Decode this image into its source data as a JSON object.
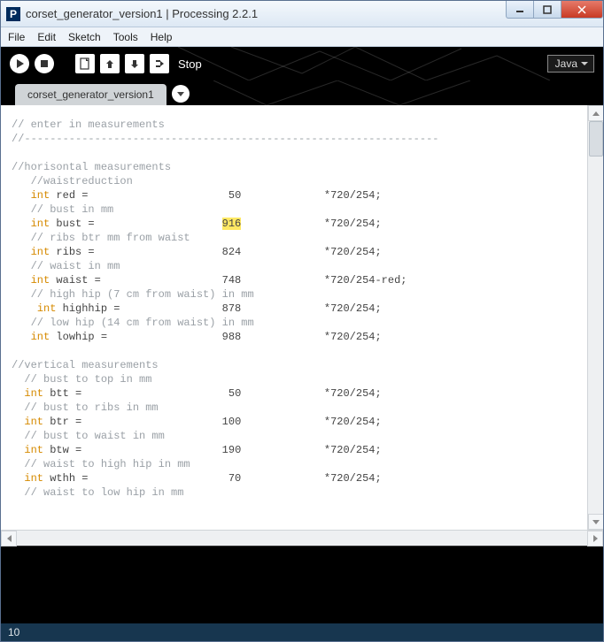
{
  "window": {
    "title": "corset_generator_version1 | Processing 2.2.1"
  },
  "menu": {
    "file": "File",
    "edit": "Edit",
    "sketch": "Sketch",
    "tools": "Tools",
    "help": "Help"
  },
  "toolbar": {
    "stop_label": "Stop",
    "mode": "Java"
  },
  "tabs": {
    "active": "corset_generator_version1"
  },
  "code": {
    "c_enter": "// enter in measurements",
    "c_rule": "//-----------------------------------------------------------------",
    "c_horiz": "//horisontal measurements",
    "c_waistred": "   //waistreduction",
    "d_red_var": " red = ",
    "d_red_val": "                     50             *720/254;",
    "c_bust": "   // bust in mm",
    "d_bust_var": " bust = ",
    "d_bust_val_pre": "                   ",
    "d_bust_hl": "916",
    "d_bust_val_post": "             *720/254;",
    "c_ribs": "   // ribs btr mm from waist",
    "d_ribs_var": " ribs = ",
    "d_ribs_val": "                   824             *720/254;",
    "c_waist": "   // waist in mm",
    "d_waist_var": " waist = ",
    "d_waist_val": "                  748             *720/254-red;",
    "c_highhip": "   // high hip (7 cm from waist) in mm",
    "d_highhip_var": " highhip = ",
    "d_highhip_val": "               878             *720/254;",
    "c_lowhip": "   // low hip (14 cm from waist) in mm",
    "d_lowhip_var": " lowhip = ",
    "d_lowhip_val": "                 988             *720/254;",
    "c_vert": "//vertical measurements",
    "c_btt": "  // bust to top in mm",
    "d_btt_var": " btt = ",
    "d_btt_val": "                      50             *720/254;",
    "c_btr": "  // bust to ribs in mm",
    "d_btr_var": " btr = ",
    "d_btr_val": "                     100             *720/254;",
    "c_btw": "  // bust to waist in mm",
    "d_btw_var": " btw = ",
    "d_btw_val": "                     190             *720/254;",
    "c_wthh": "  // waist to high hip in mm",
    "d_wthh_var": " wthh = ",
    "d_wthh_val": "                     70             *720/254;",
    "c_wtlh": "  // waist to low hip in mm",
    "kw_int": "int"
  },
  "status": {
    "line": "10"
  }
}
